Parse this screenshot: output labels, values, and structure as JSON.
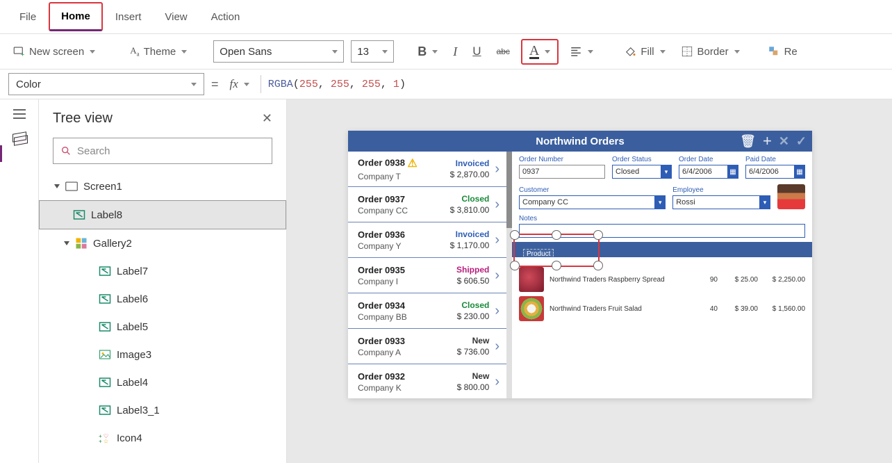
{
  "menu": {
    "file": "File",
    "home": "Home",
    "insert": "Insert",
    "view": "View",
    "action": "Action"
  },
  "toolbar": {
    "newScreen": "New screen",
    "theme": "Theme",
    "font": "Open Sans",
    "size": "13",
    "fill": "Fill",
    "border": "Border",
    "re": "Re"
  },
  "formula": {
    "property": "Color",
    "eq": "=",
    "fx": "fx",
    "fn": "RGBA",
    "args": [
      "255",
      "255",
      "255",
      "1"
    ]
  },
  "tree": {
    "title": "Tree view",
    "searchPlaceholder": "Search",
    "nodes": {
      "screen1": "Screen1",
      "label8": "Label8",
      "gallery2": "Gallery2",
      "label7": "Label7",
      "label6": "Label6",
      "label5": "Label5",
      "image3": "Image3",
      "label4": "Label4",
      "label3_1": "Label3_1",
      "icon4": "Icon4"
    }
  },
  "app": {
    "title": "Northwind Orders",
    "orders": [
      {
        "id": "Order 0938",
        "co": "Company T",
        "status": "Invoiced",
        "statusClass": "st-invoiced",
        "amt": "$ 2,870.00",
        "warn": true
      },
      {
        "id": "Order 0937",
        "co": "Company CC",
        "status": "Closed",
        "statusClass": "st-closed",
        "amt": "$ 3,810.00"
      },
      {
        "id": "Order 0936",
        "co": "Company Y",
        "status": "Invoiced",
        "statusClass": "st-invoiced",
        "amt": "$ 1,170.00"
      },
      {
        "id": "Order 0935",
        "co": "Company I",
        "status": "Shipped",
        "statusClass": "st-shipped",
        "amt": "$ 606.50"
      },
      {
        "id": "Order 0934",
        "co": "Company BB",
        "status": "Closed",
        "statusClass": "st-closed",
        "amt": "$ 230.00"
      },
      {
        "id": "Order 0933",
        "co": "Company A",
        "status": "New",
        "statusClass": "st-new",
        "amt": "$ 736.00"
      },
      {
        "id": "Order 0932",
        "co": "Company K",
        "status": "New",
        "statusClass": "st-new",
        "amt": "$ 800.00"
      }
    ],
    "detail": {
      "labels": {
        "orderNumber": "Order Number",
        "orderStatus": "Order Status",
        "orderDate": "Order Date",
        "paidDate": "Paid Date",
        "customer": "Customer",
        "employee": "Employee",
        "notes": "Notes",
        "product": "Product"
      },
      "values": {
        "orderNumber": "0937",
        "orderStatus": "Closed",
        "orderDate": "6/4/2006",
        "paidDate": "6/4/2006",
        "customer": "Company CC",
        "employee": "Rossi"
      }
    },
    "lines": [
      {
        "name": "Northwind Traders Raspberry Spread",
        "qty": "90",
        "price": "$ 25.00",
        "total": "$ 2,250.00"
      },
      {
        "name": "Northwind Traders Fruit Salad",
        "qty": "40",
        "price": "$ 39.00",
        "total": "$ 1,560.00"
      }
    ]
  }
}
